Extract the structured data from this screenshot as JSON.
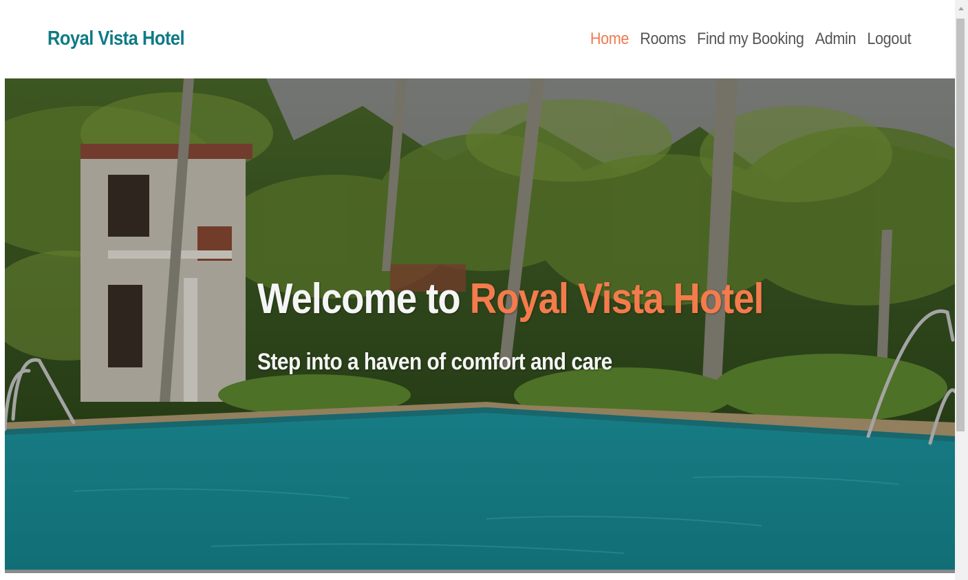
{
  "navbar": {
    "brand": "Royal Vista Hotel",
    "links": [
      {
        "label": "Home",
        "active": true
      },
      {
        "label": "Rooms",
        "active": false
      },
      {
        "label": "Find my Booking",
        "active": false
      },
      {
        "label": "Admin",
        "active": false
      },
      {
        "label": "Logout",
        "active": false
      }
    ]
  },
  "hero": {
    "title_prefix": "Welcome to ",
    "title_accent": "Royal Vista Hotel",
    "subtitle": "Step into a haven of comfort and care"
  },
  "colors": {
    "brand": "#0f7a86",
    "accent": "#f47b4c",
    "nav_text": "#555555"
  }
}
